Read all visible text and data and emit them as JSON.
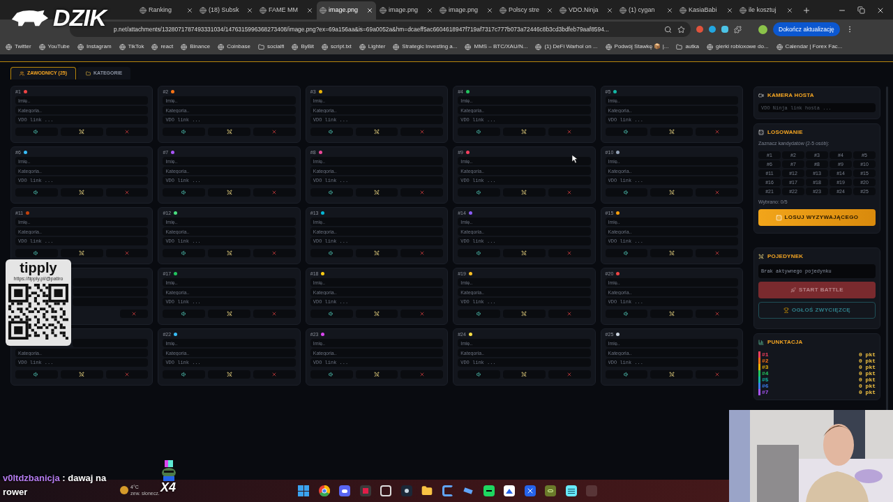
{
  "overlay": {
    "logo": "DZIK",
    "tipply": {
      "brand": "tipply",
      "url": "https://tipply.pl/@patiro"
    },
    "chat": {
      "user": "v0ltdzbanicja",
      "message": ": dawaj na rower"
    },
    "weather": {
      "temp": "4°C",
      "condition": "zew. słonecz."
    },
    "emote": {
      "count": "X4"
    }
  },
  "browser": {
    "tabs": [
      {
        "title": "Ranking",
        "selected": false
      },
      {
        "title": "(18) Subsk",
        "selected": false
      },
      {
        "title": "FAME MM",
        "selected": false
      },
      {
        "title": "image.png",
        "selected": true
      },
      {
        "title": "image.png",
        "selected": false
      },
      {
        "title": "image.png",
        "selected": false
      },
      {
        "title": "Polscy stre",
        "selected": false
      },
      {
        "title": "VDO.Ninja",
        "selected": false
      },
      {
        "title": "(1) cygan",
        "selected": false
      },
      {
        "title": "KasiaBabi",
        "selected": false
      },
      {
        "title": "ile kosztuj",
        "selected": false
      }
    ],
    "address": "p.net/attachments/1328071787493331034/1476315996368273408/image.png?ex=69a156aa&is=69a0052a&hm=dcaeff5ac6604618947f719af7317c777b073a72446c8b3cd3bdfeb79aaf8594...",
    "update_button": "Dokończ aktualizację",
    "bookmarks": [
      {
        "label": "Twitter",
        "kind": "site"
      },
      {
        "label": "YouTube",
        "kind": "site"
      },
      {
        "label": "Instagram",
        "kind": "site"
      },
      {
        "label": "TikTok",
        "kind": "site"
      },
      {
        "label": "react",
        "kind": "site"
      },
      {
        "label": "Binance",
        "kind": "site"
      },
      {
        "label": "Coinbase",
        "kind": "site"
      },
      {
        "label": "socialfi",
        "kind": "folder"
      },
      {
        "label": "ByBit",
        "kind": "site"
      },
      {
        "label": "script.txt",
        "kind": "site"
      },
      {
        "label": "Lighter",
        "kind": "site"
      },
      {
        "label": "Strategic Investing a...",
        "kind": "site"
      },
      {
        "label": "MMS – BTC/XAU/N...",
        "kind": "site"
      },
      {
        "label": "(1) DeFi Warhol on ...",
        "kind": "site"
      },
      {
        "label": "Podwój Stawkę 📦 |...",
        "kind": "site"
      },
      {
        "label": "autka",
        "kind": "folder"
      },
      {
        "label": "gierki robloxowe do...",
        "kind": "site"
      },
      {
        "label": "Calendar | Forex Fac...",
        "kind": "site"
      }
    ]
  },
  "page": {
    "tabs": [
      {
        "label": "ZAWODNICY (25)",
        "selected": true
      },
      {
        "label": "KATEGORIE",
        "selected": false
      }
    ],
    "cards": [
      {
        "kind": "card",
        "number": "#1",
        "color": "#ef4444",
        "fields": [
          {
            "placeholder": "Imię.."
          },
          {
            "placeholder": "Kategoria.."
          },
          {
            "placeholder": "VDO link ..."
          }
        ]
      },
      {
        "kind": "card",
        "number": "#2",
        "color": "#f97316",
        "fields": [
          {
            "placeholder": "Imię.."
          },
          {
            "placeholder": "Kategoria.."
          },
          {
            "placeholder": "VDO link ..."
          }
        ]
      },
      {
        "kind": "card",
        "number": "#3",
        "color": "#eab308",
        "fields": [
          {
            "placeholder": "Imię.."
          },
          {
            "placeholder": "Kategoria.."
          },
          {
            "placeholder": "VDO link ..."
          }
        ]
      },
      {
        "kind": "card",
        "number": "#4",
        "color": "#22c55e",
        "fields": [
          {
            "placeholder": "Imię.."
          },
          {
            "placeholder": "Kategoria.."
          },
          {
            "placeholder": "VDO link ..."
          }
        ]
      },
      {
        "kind": "card",
        "number": "#5",
        "color": "#14b8a6",
        "fields": [
          {
            "placeholder": "Imię.."
          },
          {
            "placeholder": "Kategoria.."
          },
          {
            "placeholder": "VDO link ..."
          }
        ]
      },
      {
        "kind": "card",
        "number": "#6",
        "color": "#38bdf8",
        "fields": [
          {
            "placeholder": "Imię.."
          },
          {
            "placeholder": "Kategoria.."
          },
          {
            "placeholder": "VDO link ..."
          }
        ]
      },
      {
        "kind": "card",
        "number": "#7",
        "color": "#a855f7",
        "fields": [
          {
            "placeholder": "Imię.."
          },
          {
            "placeholder": "Kategoria.."
          },
          {
            "placeholder": "VDO link ..."
          }
        ]
      },
      {
        "kind": "card",
        "number": "#8",
        "color": "#ec4899",
        "fields": [
          {
            "placeholder": "Imię.."
          },
          {
            "placeholder": "Kategoria.."
          },
          {
            "placeholder": "VDO link ..."
          }
        ]
      },
      {
        "kind": "card",
        "number": "#9",
        "color": "#f43f5e",
        "fields": [
          {
            "placeholder": "Imię.."
          },
          {
            "placeholder": "Kategoria.."
          },
          {
            "placeholder": "VDO link ..."
          }
        ]
      },
      {
        "kind": "card",
        "number": "#10",
        "color": "#94a3b8",
        "fields": [
          {
            "placeholder": "Imię.."
          },
          {
            "placeholder": "Kategoria.."
          },
          {
            "placeholder": "VDO link ..."
          }
        ]
      },
      {
        "kind": "card",
        "number": "#11",
        "color": "#c2410c",
        "fields": [
          {
            "placeholder": "Imię.."
          },
          {
            "placeholder": "Kategoria.."
          },
          {
            "placeholder": "VDO link ..."
          }
        ]
      },
      {
        "kind": "card",
        "number": "#12",
        "color": "#4ade80",
        "fields": [
          {
            "placeholder": "Imię.."
          },
          {
            "placeholder": "Kategoria.."
          },
          {
            "placeholder": "VDO link ..."
          }
        ]
      },
      {
        "kind": "card",
        "number": "#13",
        "color": "#06b6d4",
        "fields": [
          {
            "placeholder": "Imię.."
          },
          {
            "placeholder": "Kategoria.."
          },
          {
            "placeholder": "VDO link ..."
          }
        ]
      },
      {
        "kind": "card",
        "number": "#14",
        "color": "#8b5cf6",
        "fields": [
          {
            "placeholder": "Imię.."
          },
          {
            "placeholder": "Kategoria.."
          },
          {
            "placeholder": "VDO link ..."
          }
        ]
      },
      {
        "kind": "card",
        "number": "#15",
        "color": "#f59e0b",
        "fields": [
          {
            "placeholder": "Imię.."
          },
          {
            "placeholder": "Kategoria.."
          },
          {
            "placeholder": "VDO link ..."
          }
        ]
      },
      {
        "kind": "covered"
      },
      {
        "kind": "card",
        "number": "#17",
        "color": "#22c55e",
        "fields": [
          {
            "placeholder": "Imię.."
          },
          {
            "placeholder": "Kategoria.."
          },
          {
            "placeholder": "VDO link ..."
          }
        ]
      },
      {
        "kind": "card",
        "number": "#18",
        "color": "#facc15",
        "fields": [
          {
            "placeholder": "Imię.."
          },
          {
            "placeholder": "Kategoria.."
          },
          {
            "placeholder": "VDO link ..."
          }
        ]
      },
      {
        "kind": "card",
        "number": "#19",
        "color": "#fbbf24",
        "fields": [
          {
            "placeholder": "Imię.."
          },
          {
            "placeholder": "Kategoria.."
          },
          {
            "placeholder": "VDO link ..."
          }
        ]
      },
      {
        "kind": "card",
        "number": "#20",
        "color": "#ef4444",
        "fields": [
          {
            "placeholder": "Imię.."
          },
          {
            "placeholder": "Kategoria.."
          },
          {
            "placeholder": "VDO link ..."
          }
        ]
      },
      {
        "kind": "partly_covered",
        "fields": [
          {
            "placeholder": "Kategoria.."
          },
          {
            "placeholder": "VDO link ..."
          }
        ]
      },
      {
        "kind": "card",
        "number": "#22",
        "color": "#38bdf8",
        "fields": [
          {
            "placeholder": "Imię.."
          },
          {
            "placeholder": "Kategoria.."
          },
          {
            "placeholder": "VDO link ..."
          }
        ]
      },
      {
        "kind": "card",
        "number": "#23",
        "color": "#d946ef",
        "fields": [
          {
            "placeholder": "Imię.."
          },
          {
            "placeholder": "Kategoria.."
          },
          {
            "placeholder": "VDO link ..."
          }
        ]
      },
      {
        "kind": "card",
        "number": "#24",
        "color": "#fde047",
        "fields": [
          {
            "placeholder": "Imię.."
          },
          {
            "placeholder": "Kategoria.."
          },
          {
            "placeholder": "VDO link ..."
          }
        ]
      },
      {
        "kind": "card",
        "number": "#25",
        "color": "#cbd5e1",
        "fields": [
          {
            "placeholder": "Imię.."
          },
          {
            "placeholder": "Kategoria.."
          },
          {
            "placeholder": "VDO link ..."
          }
        ]
      }
    ],
    "sidebar": {
      "host_camera": {
        "title": "KAMERA HOSTA",
        "placeholder": "VDO Ninja link hosta ..."
      },
      "draw": {
        "title": "LOSOWANIE",
        "hint": "Zaznacz kandydatów (2-5 osób):",
        "candidates": [
          {
            "label": "#1",
            "selected": false
          },
          {
            "label": "#2",
            "selected": false
          },
          {
            "label": "#3",
            "selected": false
          },
          {
            "label": "#4",
            "selected": false
          },
          {
            "label": "#5",
            "selected": false
          },
          {
            "label": "#6",
            "selected": false
          },
          {
            "label": "#7",
            "selected": false
          },
          {
            "label": "#8",
            "selected": false
          },
          {
            "label": "#9",
            "selected": false
          },
          {
            "label": "#10",
            "selected": false
          },
          {
            "label": "#11",
            "selected": false
          },
          {
            "label": "#12",
            "selected": false
          },
          {
            "label": "#13",
            "selected": false
          },
          {
            "label": "#14",
            "selected": false
          },
          {
            "label": "#15",
            "selected": false
          },
          {
            "label": "#16",
            "selected": false
          },
          {
            "label": "#17",
            "selected": false
          },
          {
            "label": "#18",
            "selected": false
          },
          {
            "label": "#19",
            "selected": false
          },
          {
            "label": "#20",
            "selected": false
          },
          {
            "label": "#21",
            "selected": false
          },
          {
            "label": "#22",
            "selected": false
          },
          {
            "label": "#23",
            "selected": false
          },
          {
            "label": "#24",
            "selected": false
          },
          {
            "label": "#25",
            "selected": false
          }
        ],
        "selected_count": "Wybrano: 0/5",
        "button": "LOSUJ WYZYWAJĄCEGO"
      },
      "duel": {
        "title": "POJEDYNEK",
        "status": "Brak aktywnego pojedynku",
        "start_button": {
          "label": "START BATTLE",
          "disabled": true
        },
        "winner_button": {
          "label": "OGŁOŚ ZWYCIĘZCĘ",
          "disabled": true
        }
      },
      "scores": {
        "title": "PUNKTACJA",
        "rows": [
          {
            "label": "#1",
            "points": "0 pkt",
            "color": "#f43f5e"
          },
          {
            "label": "#2",
            "points": "0 pkt",
            "color": "#f97316"
          },
          {
            "label": "#3",
            "points": "0 pkt",
            "color": "#eab308"
          },
          {
            "label": "#4",
            "points": "0 pkt",
            "color": "#22c55e"
          },
          {
            "label": "#5",
            "points": "0 pkt",
            "color": "#14b8a6"
          },
          {
            "label": "#6",
            "points": "0 pkt",
            "color": "#3b82f6"
          },
          {
            "label": "#7",
            "points": "0 pkt",
            "color": "#a855f7"
          }
        ]
      }
    }
  },
  "taskbar": {
    "apps": [
      {
        "kind": "windows"
      },
      {
        "kind": "chrome"
      },
      {
        "kind": "discord"
      },
      {
        "kind": "red-app"
      },
      {
        "kind": "gear"
      },
      {
        "kind": "steam"
      },
      {
        "kind": "folder"
      },
      {
        "kind": "c-app"
      },
      {
        "kind": "network"
      },
      {
        "kind": "spotify"
      },
      {
        "kind": "photos"
      },
      {
        "kind": "x-app"
      },
      {
        "kind": "game"
      },
      {
        "kind": "notepad"
      },
      {
        "kind": "blank"
      }
    ]
  }
}
